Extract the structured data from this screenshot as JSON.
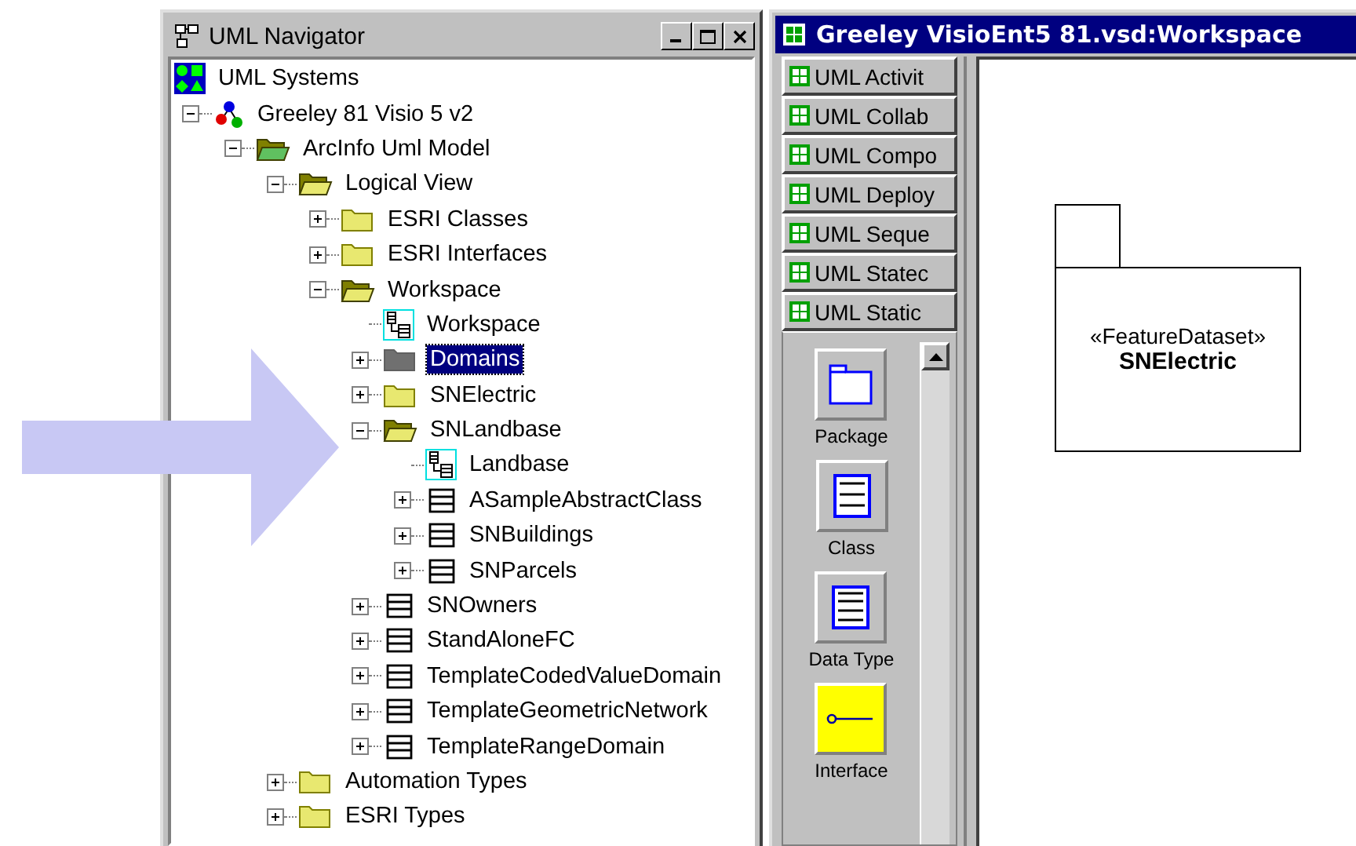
{
  "navigator": {
    "title": "UML Navigator",
    "tree": [
      {
        "label": "UML Systems",
        "kind": "systems",
        "selected": false,
        "children": [
          {
            "label": "Greeley 81 Visio 5 v2",
            "kind": "model",
            "expanded": true,
            "selected": false,
            "children": [
              {
                "label": "ArcInfo Uml Model",
                "kind": "folder-green",
                "expanded": true,
                "selected": false,
                "children": [
                  {
                    "label": "Logical View",
                    "kind": "folder",
                    "expanded": true,
                    "selected": false,
                    "children": [
                      {
                        "label": "ESRI Classes",
                        "kind": "folder",
                        "expanded": false,
                        "selected": false
                      },
                      {
                        "label": "ESRI Interfaces",
                        "kind": "folder",
                        "expanded": false,
                        "selected": false
                      },
                      {
                        "label": "Workspace",
                        "kind": "folder",
                        "expanded": true,
                        "selected": false,
                        "children": [
                          {
                            "label": "Workspace",
                            "kind": "diagram",
                            "selected": false
                          },
                          {
                            "label": "Domains",
                            "kind": "folder-grey",
                            "expanded": false,
                            "selected": true
                          },
                          {
                            "label": "SNElectric",
                            "kind": "folder",
                            "expanded": false,
                            "selected": false
                          },
                          {
                            "label": "SNLandbase",
                            "kind": "folder",
                            "expanded": true,
                            "selected": false,
                            "children": [
                              {
                                "label": "Landbase",
                                "kind": "diagram",
                                "selected": false
                              },
                              {
                                "label": "ASampleAbstractClass",
                                "kind": "class",
                                "expanded": false,
                                "selected": false
                              },
                              {
                                "label": "SNBuildings",
                                "kind": "class",
                                "expanded": false,
                                "selected": false
                              },
                              {
                                "label": "SNParcels",
                                "kind": "class",
                                "expanded": false,
                                "selected": false
                              }
                            ]
                          },
                          {
                            "label": "SNOwners",
                            "kind": "class",
                            "expanded": false,
                            "selected": false
                          },
                          {
                            "label": "StandAloneFC",
                            "kind": "class",
                            "expanded": false,
                            "selected": false
                          },
                          {
                            "label": "TemplateCodedValueDomain",
                            "kind": "class",
                            "expanded": false,
                            "selected": false
                          },
                          {
                            "label": "TemplateGeometricNetwork",
                            "kind": "class",
                            "expanded": false,
                            "selected": false
                          },
                          {
                            "label": "TemplateRangeDomain",
                            "kind": "class",
                            "expanded": false,
                            "selected": false
                          }
                        ]
                      }
                    ]
                  },
                  {
                    "label": "Automation Types",
                    "kind": "folder",
                    "expanded": false,
                    "selected": false
                  },
                  {
                    "label": "ESRI Types",
                    "kind": "folder",
                    "expanded": false,
                    "selected": false
                  }
                ]
              }
            ]
          }
        ]
      }
    ]
  },
  "workspace": {
    "title": "Greeley VisioEnt5 81.vsd:Workspace",
    "stencil_tabs": [
      {
        "label": "UML Activit"
      },
      {
        "label": "UML Collab"
      },
      {
        "label": "UML Compo"
      },
      {
        "label": "UML Deploy"
      },
      {
        "label": "UML Seque"
      },
      {
        "label": "UML Statec"
      },
      {
        "label": "UML Static"
      }
    ],
    "shapes": [
      {
        "label": "Package",
        "kind": "package"
      },
      {
        "label": "Class",
        "kind": "class"
      },
      {
        "label": "Data Type",
        "kind": "datatype"
      },
      {
        "label": "Interface",
        "kind": "interface"
      }
    ],
    "canvas": {
      "package": {
        "stereotype": "«FeatureDataset»",
        "name": "SNElectric"
      }
    }
  }
}
